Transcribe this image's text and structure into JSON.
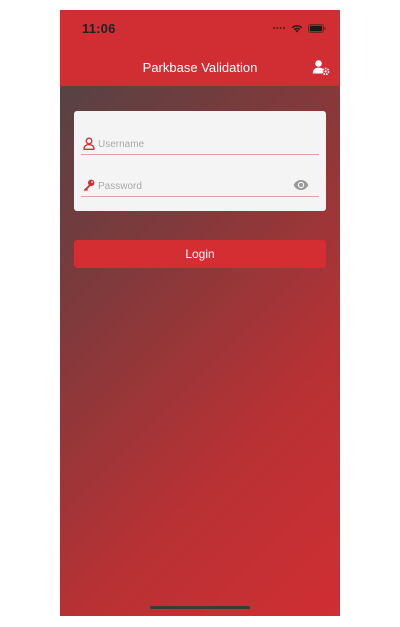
{
  "status_bar": {
    "time": "11:06",
    "icons": [
      "signal-dots-icon",
      "wifi-icon",
      "battery-icon"
    ]
  },
  "navbar": {
    "title": "Parkbase Validation",
    "right_icon": "user-settings-icon"
  },
  "login_form": {
    "username": {
      "icon": "user-icon",
      "placeholder": "Username",
      "value": ""
    },
    "password": {
      "icon": "key-icon",
      "placeholder": "Password",
      "value": "",
      "toggle_icon": "eye-icon"
    }
  },
  "login_button": {
    "label": "Login"
  },
  "colors": {
    "primary_red": "#d02e33",
    "gradient_dark": "#4a4546",
    "card_background": "#f4f4f4",
    "field_underline": "#e7a0a2"
  }
}
